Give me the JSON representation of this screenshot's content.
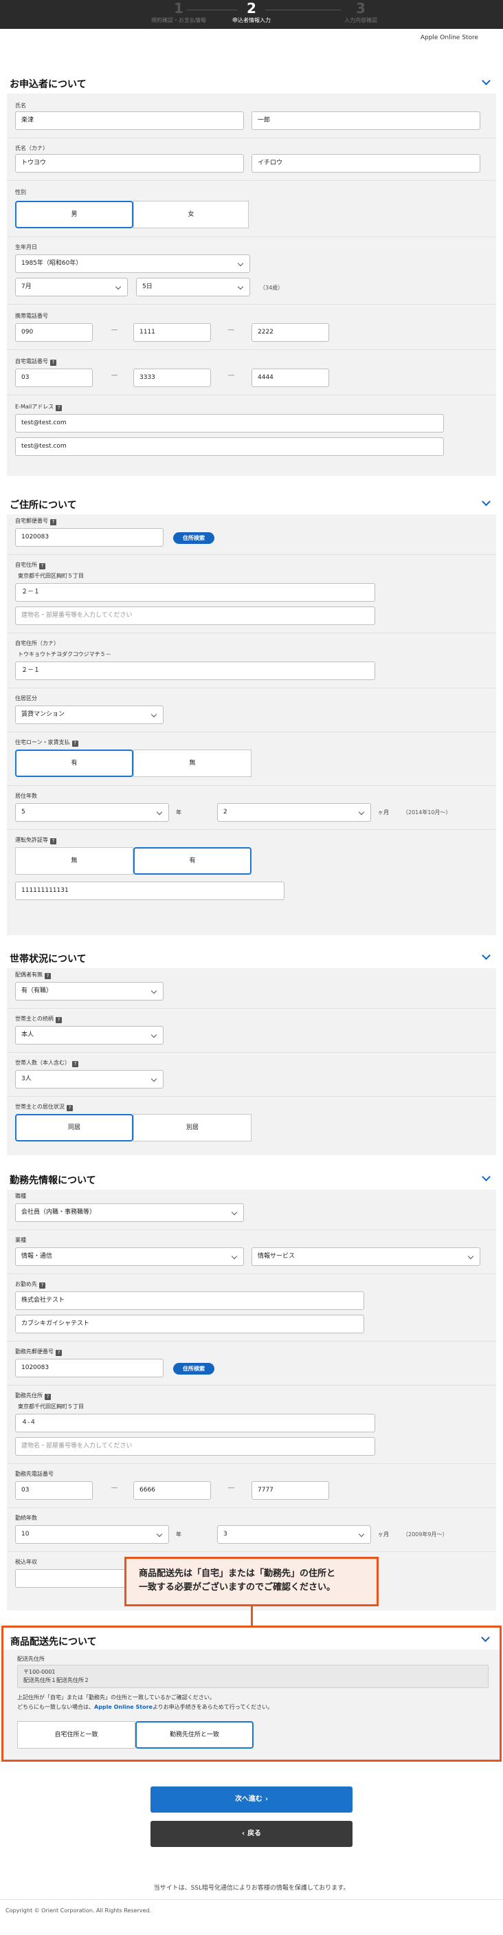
{
  "steps": [
    {
      "num": "1",
      "label": "規約確認・お支払情報"
    },
    {
      "num": "2",
      "label": "申込者情報入力"
    },
    {
      "num": "3",
      "label": "入力内容確認"
    }
  ],
  "store": "Apple Online Store",
  "applicant": {
    "title": "お申込者について",
    "name_label": "氏名",
    "last_name": "楽津",
    "first_name": "一郎",
    "kana_label": "氏名（カナ）",
    "last_kana": "トウヨウ",
    "first_kana": "イチロウ",
    "gender_label": "性別",
    "male": "男",
    "female": "女",
    "birth_label": "生年月日",
    "birth_year": "1985年（昭和60年）",
    "birth_month": "7月",
    "birth_day": "5日",
    "age": "（34歳）",
    "mobile_label": "携帯電話番号",
    "mobile": [
      "090",
      "1111",
      "2222"
    ],
    "home_label": "自宅電話番号",
    "home": [
      "03",
      "3333",
      "4444"
    ],
    "email_label": "E-Mailアドレス",
    "email": "test@test.com",
    "email_confirm": "test@test.com"
  },
  "address": {
    "title": "ご住所について",
    "zip_label": "自宅郵便番号",
    "zip": "1020083",
    "search": "住所検索",
    "addr_label": "自宅住所",
    "addr_text": "東京都千代田区麹町５丁目",
    "addr1": "２－１",
    "addr2_ph": "建物名・部屋番号等を入力してください",
    "kana_label": "自宅住所（カナ）",
    "kana_text": "トウキョウトチヨダクコウジマチ５－",
    "kana1": "２－１",
    "type_label": "住居区分",
    "type": "賃貸マンション",
    "loan_label": "住宅ローン・家賃支払",
    "yes": "有",
    "no": "無",
    "years_label": "居住年数",
    "years": "5",
    "years_unit": "年",
    "months": "2",
    "months_unit": "ヶ月",
    "since": "（2014年10月～）",
    "license_label": "運転免許証等",
    "license_no": "無",
    "license_yes": "有",
    "license_number": "111111111131"
  },
  "household": {
    "title": "世帯状況について",
    "spouse_label": "配偶者有無",
    "spouse": "有（有職）",
    "relation_label": "世帯主との続柄",
    "relation": "本人",
    "count_label": "世帯人数（本人含む）",
    "count": "3人",
    "living_label": "世帯主との居住状況",
    "together": "同居",
    "apart": "別居"
  },
  "employment": {
    "title": "勤務先情報について",
    "job_label": "職種",
    "job": "会社員（内職・事務職等）",
    "industry_label": "業種",
    "industry": "情報・通信",
    "industry_sub": "情報サービス",
    "company_label": "お勤め先",
    "company": "株式会社テスト",
    "company_kana": "カブシキガイシャテスト",
    "zip_label": "勤務先郵便番号",
    "zip": "1020083",
    "search": "住所検索",
    "addr_label": "勤務先住所",
    "addr_text": "東京都千代田区麹町５丁目",
    "addr1": "４-４",
    "addr2_ph": "建物名・部屋番号等を入力してください",
    "tel_label": "勤務先電話番号",
    "tel": [
      "03",
      "6666",
      "7777"
    ],
    "years_label": "勤続年数",
    "years": "10",
    "years_unit": "年",
    "months": "3",
    "months_unit": "ヶ月",
    "since": "（2009年9月～）",
    "income_label": "税込年収"
  },
  "callout": {
    "line1": "商品配送先は「自宅」または「勤務先」の住所と",
    "line2": "一致する必要がございますのでご確認ください。"
  },
  "delivery": {
    "title": "商品配送先について",
    "label": "配送先住所",
    "zip": "〒100-0001",
    "addr": "配送先住所１配送先住所２",
    "note1": "上記住所が「自宅」または「勤務先」の住所と一致しているかご確認ください。",
    "note2a": "どちらにも一致しない場合は、",
    "note2b": "Apple Online Store",
    "note2c": "よりお申込手続きをあらためて行ってください。",
    "home_btn": "自宅住所と一致",
    "work_btn": "勤務先住所と一致"
  },
  "next": "次へ進む",
  "back": "戻る",
  "ssl": "当サイトは、SSL暗号化通信によりお客様の情報を保護しております。",
  "copyright": "Copyright © Orient Corporation. All Rights Reserved.",
  "colors": {
    "accent": "#1565c0",
    "alert": "#e8561c"
  }
}
